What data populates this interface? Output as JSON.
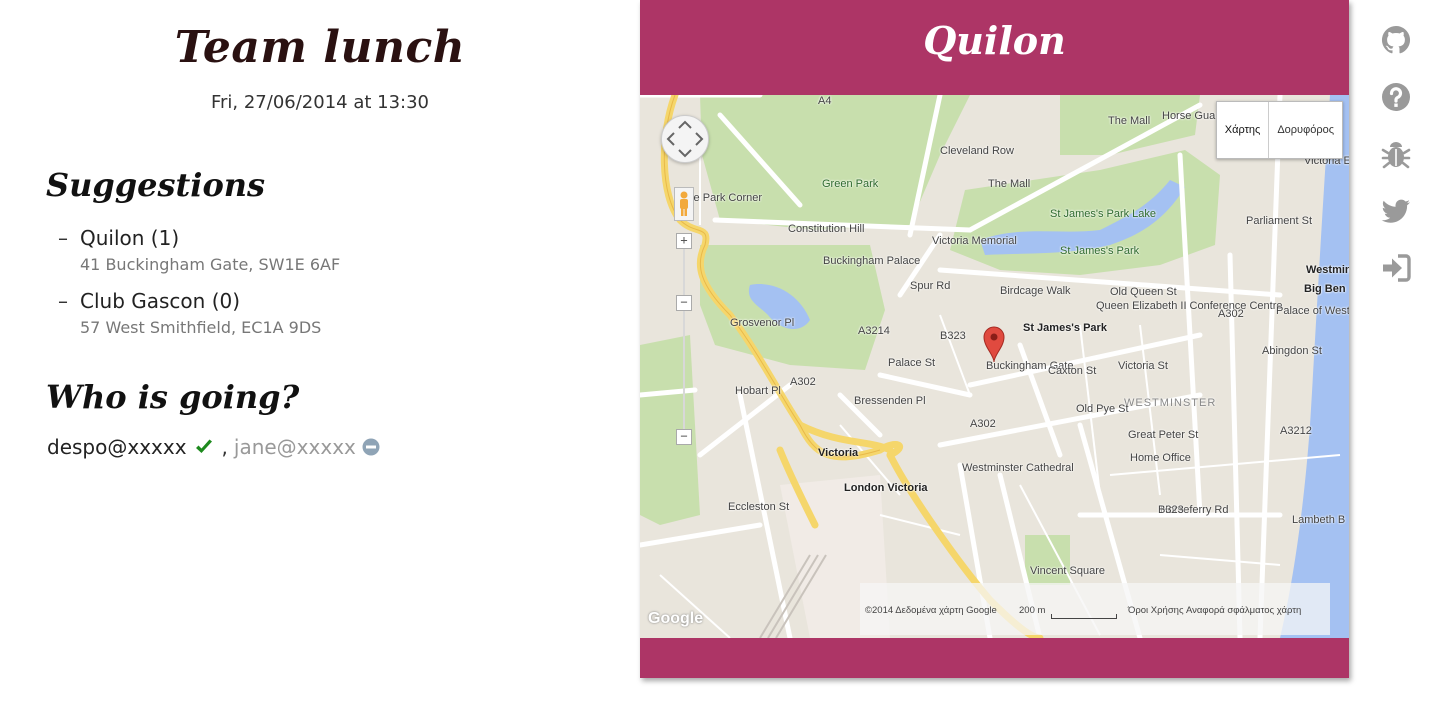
{
  "event": {
    "title": "Team lunch",
    "date": "Fri, 27/06/2014 at 13:30"
  },
  "suggestions": {
    "heading": "Suggestions",
    "items": [
      {
        "dash": "–",
        "name": "Quilon (1)",
        "address": "41 Buckingham Gate, SW1E 6AF"
      },
      {
        "dash": "–",
        "name": "Club Gascon (0)",
        "address": "57 West Smithfield, EC1A 9DS"
      }
    ]
  },
  "attendance": {
    "heading": "Who is going?",
    "people": [
      {
        "email": "despo@xxxxx",
        "status": "going",
        "icon": "check-icon"
      },
      {
        "email": "jane@xxxxx",
        "status": "not-going",
        "icon": "minus-circle-icon"
      }
    ],
    "separator": ","
  },
  "restaurant": {
    "name": "Quilon",
    "map": {
      "type_buttons": [
        "Χάρτης",
        "Δορυφόρος"
      ],
      "footer": {
        "copyright": "©2014 Δεδομένα χάρτη Google",
        "scale": "200 m",
        "terms": "Όροι Χρήσης",
        "report": "Αναφορά σφάλματος χάρτη"
      },
      "logo": "Google",
      "zoom_in": "+",
      "zoom_out": "−",
      "labels": {
        "green_park": "Green Park",
        "constitution_hill": "Constitution Hill",
        "the_mall": "The Mall",
        "the_mall_2": "The Mall",
        "st_james_park_lake": "St James's Park Lake",
        "st_james_park": "St James's Park",
        "victoria_memorial": "Victoria Memorial",
        "buckingham_palace": "Buckingham Palace",
        "birdcage_walk": "Birdcage Walk",
        "queen_elizabeth": "Queen Elizabeth II Conference Centre",
        "st_james_station": "St James's Park",
        "westminster": "WESTMINSTER",
        "victoria_st": "Victoria St",
        "buckingham_gate": "Buckingham Gate",
        "palace_st": "Palace St",
        "bressenden": "Bressenden Pl",
        "victoria_station": "Victoria",
        "london_victoria": "London Victoria",
        "westminster_cathedral": "Westminster Cathedral",
        "home_office": "Home Office",
        "horseferry_rd": "Horseferry Rd",
        "hyde_park_corner": "Hyde Park Corner",
        "big_ben": "Big Ben",
        "westminster_tube": "Westminster",
        "palace_of_westminster": "Palace of Westminster",
        "lambeth_bridge": "Lambeth B",
        "a302": "A302",
        "a3214": "A3214",
        "b323": "B323",
        "vincent_square": "Vincent Square",
        "grosvenor_pl": "Grosvenor Pl",
        "hobart_pl": "Hobart Pl",
        "eccleston_st": "Eccleston St",
        "horse_guards": "Horse Guards Parade",
        "parliament_st": "Parliament St",
        "victoria_embankment": "Victoria Embankment",
        "old_queen_st": "Old Queen St",
        "great_peter_st": "Great Peter St",
        "old_pye_st": "Old Pye St",
        "caxton_st": "Caxton St",
        "abingdon_st": "Abingdon St",
        "spur_rd": "Spur Rd",
        "cleveland_row": "Cleveland Row",
        "a4": "A4",
        "a3212": "A3212"
      }
    }
  },
  "side_menu": [
    {
      "name": "github-icon"
    },
    {
      "name": "help-icon"
    },
    {
      "name": "bug-icon"
    },
    {
      "name": "twitter-icon"
    },
    {
      "name": "sign-in-icon"
    }
  ],
  "colors": {
    "card": "#ad3566",
    "going": "#1e8a1e",
    "not_going": "#999999",
    "side_icons": "#9a9a9a"
  }
}
